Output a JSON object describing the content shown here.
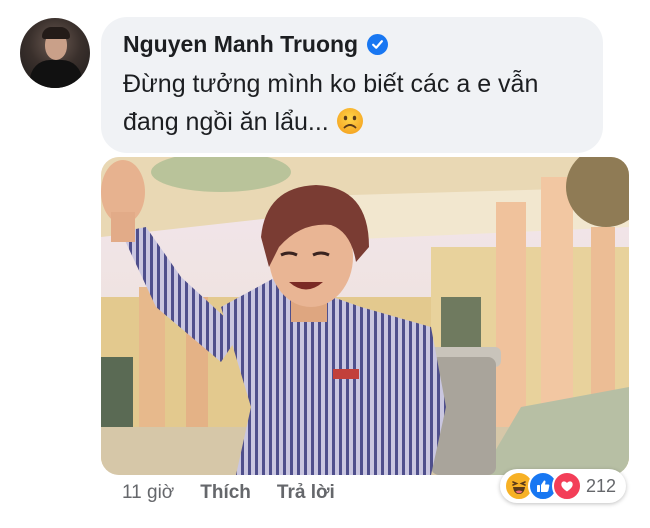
{
  "comment": {
    "author": "Nguyen Manh Truong",
    "text": "Đừng tưởng mình ko biết các a e vẫn đang ngồi ăn lẩu...",
    "text_line1": "Đừng tưởng mình ko biết các a e vẫn",
    "text_line2": "đang ngồi ăn lẩu...",
    "emoji": "frowning-face-emoji",
    "verified_icon": "verified-badge-icon"
  },
  "meta": {
    "time": "11 giờ",
    "like_label": "Thích",
    "reply_label": "Trả lời"
  },
  "reactions": {
    "icons": [
      "haha-icon",
      "like-icon",
      "love-icon"
    ],
    "count": "212"
  },
  "colors": {
    "bubble": "#f0f2f5",
    "verified": "#1877f2",
    "like": "#1877f2",
    "love": "#f33e58",
    "haha": "#f7b125",
    "meta_text": "#65676b"
  }
}
